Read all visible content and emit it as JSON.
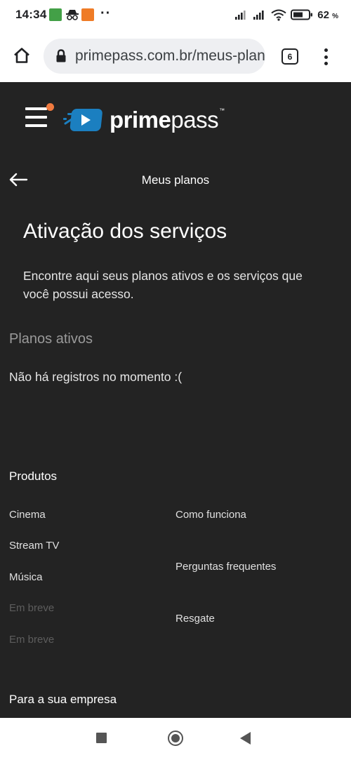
{
  "status_bar": {
    "time": "14:34",
    "battery_percent": "62",
    "percent_sign": "%",
    "icons": [
      "app-notification-icon",
      "incognito-icon",
      "flame-app-icon",
      "more-notifications-icon",
      "signal-icon",
      "signal-icon",
      "wifi-icon",
      "battery-icon"
    ]
  },
  "browser": {
    "url": "primepass.com.br/meus-planos",
    "tab_count": "6"
  },
  "header": {
    "logo_bold": "prime",
    "logo_light": "pass",
    "logo_tm": "™",
    "accent_color": "#f07a3f",
    "logo_color": "#1b7fc0"
  },
  "section": {
    "title": "Meus planos",
    "heading": "Ativação dos serviços",
    "description": "Encontre aqui seus planos ativos e os serviços que você possui acesso.",
    "plans_heading": "Planos ativos",
    "empty_message": "Não há registros no momento :("
  },
  "footer": {
    "products_title": "Produtos",
    "products": [
      "Cinema",
      "Stream TV",
      "Música",
      "Em breve",
      "Em breve"
    ],
    "help_links": [
      "Como funciona",
      "Perguntas frequentes",
      "Resgate"
    ],
    "company_title": "Para a sua empresa"
  }
}
